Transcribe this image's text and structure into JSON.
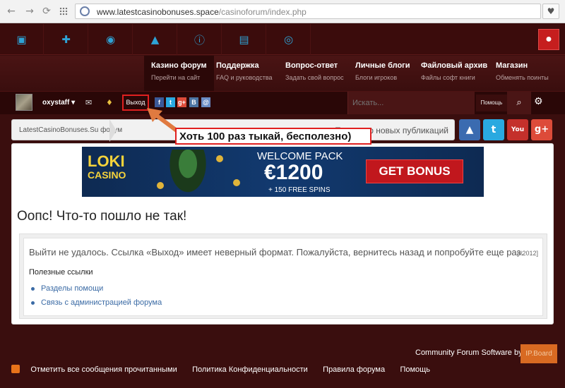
{
  "browser": {
    "url_host": "www.latestcasinobonuses.space",
    "url_path": "/casinoforum/index.php",
    "back_icon": "←",
    "forward_icon": "→",
    "reload_icon": "⟳",
    "heart_icon": "♥"
  },
  "top_icons": [
    "money-icon",
    "gift-icon",
    "gamepad-icon",
    "warning-icon",
    "info-icon",
    "book-icon",
    "chat-icon"
  ],
  "main_nav": [
    {
      "title": "Казино форум",
      "sub": "Перейти на сайт"
    },
    {
      "title": "Поддержка",
      "sub": "FAQ и руководства"
    },
    {
      "title": "Вопрос-ответ",
      "sub": "Задать свой вопрос"
    },
    {
      "title": "Личные блоги",
      "sub": "Блоги игроков"
    },
    {
      "title": "Файловый архив",
      "sub": "Файлы софт книги"
    },
    {
      "title": "Магазин",
      "sub": "Обменять поинты"
    }
  ],
  "user_bar": {
    "username": "oxystaff ▾",
    "mail_icon": "✉",
    "bell_icon": "🔔",
    "logout": "Выход",
    "mini_social": [
      "f",
      "t",
      "g+",
      "B",
      "@"
    ],
    "search_placeholder": "Искать...",
    "search_help": "Помощь",
    "search_icon": "🔍",
    "gear_icon": "⚙"
  },
  "breadcrumb": {
    "home": "LatestCasinoBonuses.Su форум",
    "new_posts": "Просмотр новых публикаций"
  },
  "social_big": [
    {
      "label": "👍",
      "color": "#3b6bb0"
    },
    {
      "label": "t",
      "color": "#2aa9e0"
    },
    {
      "label": "You",
      "color": "#c4302b"
    },
    {
      "label": "g+",
      "color": "#dd4b39"
    }
  ],
  "annotation": "Хоть 100 раз тыкай, бесполезно)",
  "banner": {
    "brand_top": "LOKI",
    "brand_bottom": "CASINO",
    "welcome": "WELCOME PACK",
    "amount": "€1200",
    "spins": "+ 150 FREE SPINS",
    "cta": "GET BONUS"
  },
  "error": {
    "title": "Оопс! Что-то пошло не так!",
    "message": "Выйти не удалось. Ссылка «Выход» имеет неверный формат. Пожалуйста, вернитесь назад и попробуйте еще раз.",
    "code": "[#2012]",
    "useful_title": "Полезные ссылки",
    "links": [
      "Разделы помощи",
      "Связь с администрацией форума"
    ]
  },
  "footer": {
    "powered": "Community Forum Software by",
    "brand": "IP.Board",
    "links": [
      "Отметить все сообщения прочитанными",
      "Политика Конфиденциальности",
      "Правила форума",
      "Помощь"
    ]
  },
  "colors": {
    "accent": "#c61e1e",
    "link": "#3b6ba5",
    "dark_bg": "#3a0e0e"
  }
}
